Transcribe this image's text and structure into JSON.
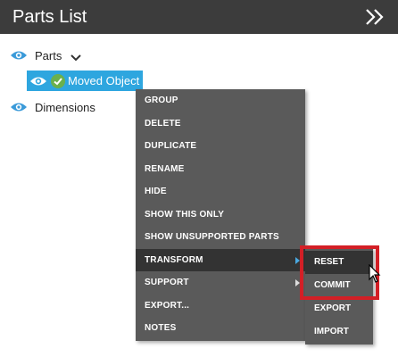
{
  "header": {
    "title": "Parts List",
    "collapse_icon": "double-chevron-right-icon"
  },
  "tree": {
    "parts_label": "Parts",
    "moved_label": "Moved Object",
    "dimensions_label": "Dimensions"
  },
  "context_menu": {
    "items": [
      "GROUP",
      "DELETE",
      "DUPLICATE",
      "RENAME",
      "HIDE",
      "SHOW THIS ONLY",
      "SHOW UNSUPPORTED PARTS",
      "TRANSFORM",
      "SUPPORT",
      "EXPORT...",
      "NOTES"
    ],
    "active": "TRANSFORM"
  },
  "submenu": {
    "items": [
      "RESET",
      "COMMIT",
      "EXPORT",
      "IMPORT"
    ]
  },
  "colors": {
    "header_bg": "#3c3c3c",
    "selection": "#2ea6df",
    "menu_bg": "#5a5a5a",
    "highlight": "#d31f26",
    "eye": "#3a9ad9",
    "check": "#6ab04c"
  }
}
